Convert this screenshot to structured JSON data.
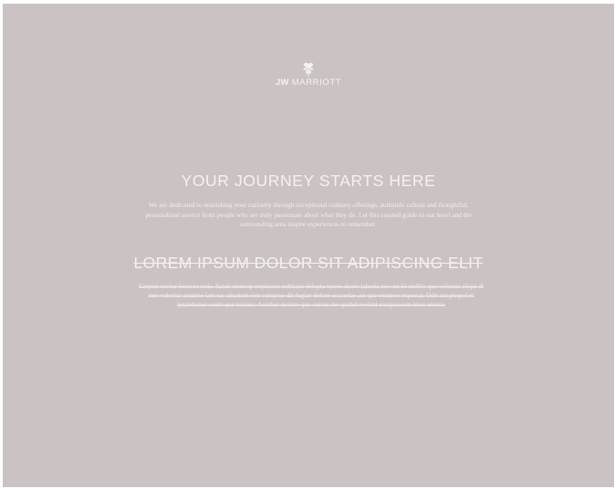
{
  "brand": {
    "logo_icon": "flower-icon",
    "jw": "JW",
    "name": "MARRIOTT"
  },
  "hero": {
    "headline": "YOUR JOURNEY STARTS HERE",
    "intro": "We are dedicated to nourishing your curiosity through exceptional culinary offerings, authentic culture and thoughtful, personalized service from people who are truly passionate about what they do. Let this curated guide to our hotel and the surrounding area inspire experiences to remember."
  },
  "placeholder": {
    "heading": "LOREM IPSUM DOLOR SIT ADIPISCING ELIT",
    "body": "Carptae nectur heracea ratia. Itatati enarcup trepitaum nobitatis delupta turcet alcore laboria nea aut lit endilic quo volorest aliqui di ime volectur audame lam ras aituatem rem voloprae dit fugiae dolore occaudae aut que vendese expectat. Odit aut pregod et ipsandamet count quo natinur. Aerobor molore quo cursus me quidel evelent exsquaesum imus essum."
  },
  "colors": {
    "background": "#cbc3c3",
    "text": "#f6f1f1"
  }
}
